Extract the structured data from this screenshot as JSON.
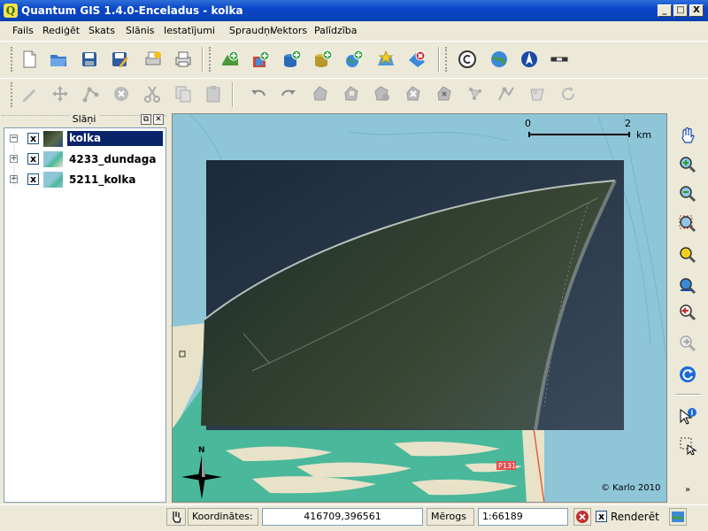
{
  "window": {
    "title": "Quantum GIS 1.4.0-Enceladus - kolka",
    "app_icon": "Q",
    "min": "_",
    "max": "□",
    "close": "X"
  },
  "menu": {
    "items": [
      "Fails",
      "Rediģēt",
      "Skats",
      "Slānis",
      "Iestatījumi",
      "Spraudņi",
      "Vektors",
      "Palīdzība"
    ]
  },
  "layers_panel": {
    "title": "Slāņi",
    "layers": [
      {
        "name": "kolka",
        "checked": "x",
        "selected": true
      },
      {
        "name": "4233_dundaga",
        "checked": "x",
        "selected": false
      },
      {
        "name": "5211_kolka",
        "checked": "x",
        "selected": false
      }
    ]
  },
  "map": {
    "scalebar_start": "0",
    "scalebar_end": "2",
    "scalebar_unit": "km",
    "copyright": "© Karlo 2010",
    "north_label": "N",
    "road_label": "P131"
  },
  "status": {
    "coordinates_label": "Koordinātes:",
    "coordinates_value": "416709,396561",
    "scale_label": "Mērogs",
    "scale_value": "1:66189",
    "render_label": "Renderēt",
    "render_checked": "x"
  }
}
